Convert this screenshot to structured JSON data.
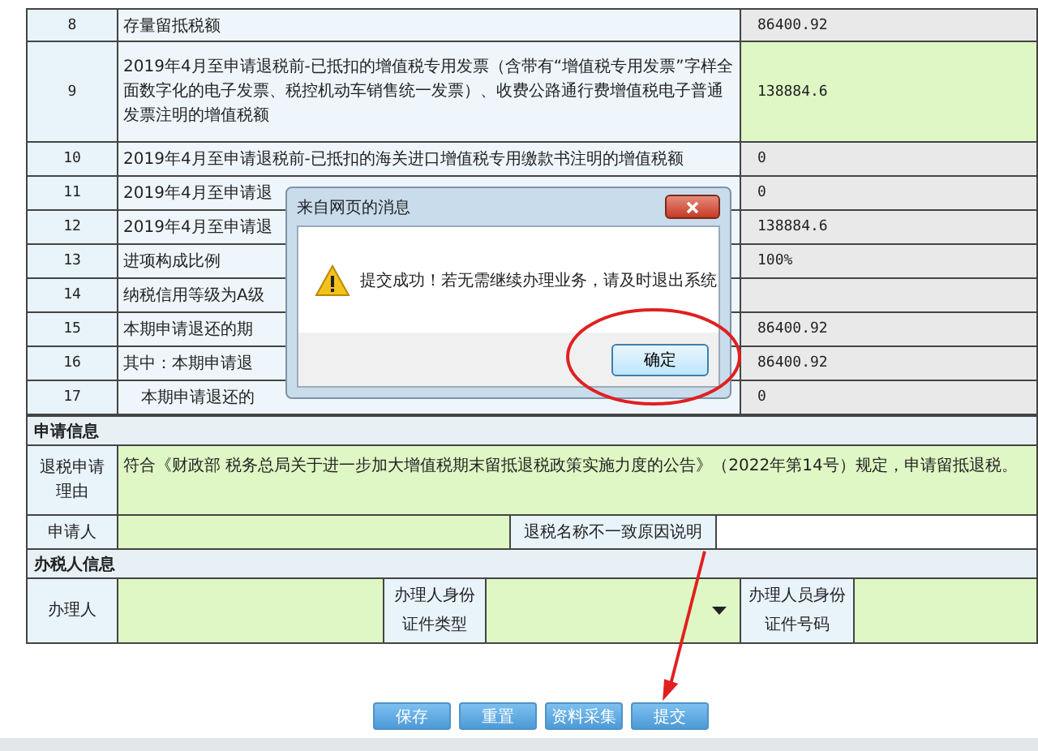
{
  "rows": [
    {
      "no": "8",
      "item": "存量留抵税额",
      "value": "86400.92",
      "editable": false
    },
    {
      "no": "9",
      "item": "2019年4月至申请退税前-已抵扣的增值税专用发票（含带有“增值税专用发票”字样全面数字化的电子发票、税控机动车销售统一发票）、收费公路通行费增值税电子普通发票注明的增值税额",
      "value": "138884.6",
      "editable": true
    },
    {
      "no": "10",
      "item": "2019年4月至申请退税前-已抵扣的海关进口增值税专用缴款书注明的增值税额",
      "value": "0",
      "editable": false
    },
    {
      "no": "11",
      "item": "2019年4月至申请退",
      "value": "0",
      "editable": false
    },
    {
      "no": "12",
      "item": "2019年4月至申请退",
      "value": "138884.6",
      "editable": false
    },
    {
      "no": "13",
      "item": "进项构成比例",
      "value": "100%",
      "editable": false
    },
    {
      "no": "14",
      "item": "纳税信用等级为A级",
      "editable": false
    },
    {
      "no": "15",
      "item": "本期申请退还的期",
      "value": "86400.92",
      "editable": false
    },
    {
      "no": "16",
      "item": "其中：本期申请退",
      "value": "86400.92",
      "editable": false
    },
    {
      "no": "17",
      "item": "本期申请退还的",
      "value": "0",
      "editable": false,
      "indented": true
    }
  ],
  "apply_section": {
    "title": "申请信息",
    "reason_label": "退税申请理由",
    "reason": "符合《财政部 税务总局关于进一步加大增值税期末留抵退税政策实施力度的公告》（2022年第14号）规定，申请留抵退税。",
    "applicant_label": "申请人",
    "mismatch_label": "退税名称不一致原因说明"
  },
  "agent_section": {
    "title": "办税人信息",
    "agent_label": "办理人",
    "id_type_label": "办理人身份证件类型",
    "id_number_label": "办理人员身份证件号码"
  },
  "buttons": [
    {
      "label": "保存"
    },
    {
      "label": "重置"
    },
    {
      "label": "资料采集"
    },
    {
      "label": "提交"
    }
  ],
  "dialog": {
    "title": "来自网页的消息",
    "message": "提交成功！若无需继续办理业务，请及时退出系统",
    "ok": "确定"
  }
}
